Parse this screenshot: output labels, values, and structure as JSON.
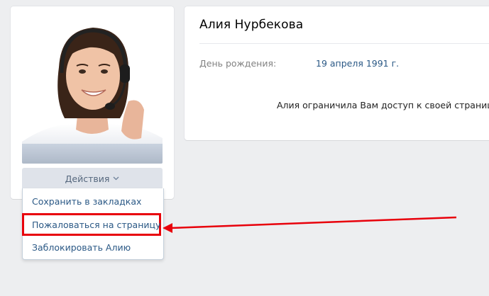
{
  "profile": {
    "name": "Алия Нурбекова",
    "birthday_label": "День рождения:",
    "birthday_value": "19 апреля 1991 г.",
    "notice": "Алия ограничила Вам доступ к своей странице."
  },
  "actions": {
    "button_label": "Действия",
    "items": [
      {
        "label": "Сохранить в закладках"
      },
      {
        "label": "Пожаловаться на страницу"
      },
      {
        "label": "Заблокировать Алию"
      }
    ]
  },
  "colors": {
    "page_bg": "#edeef0",
    "link": "#2a5885",
    "highlight": "#e8000b",
    "arrow": "#e8000b"
  },
  "icons": {
    "actions_chevron": "chevron-down-icon",
    "annotation": "red-arrow-annotation"
  }
}
